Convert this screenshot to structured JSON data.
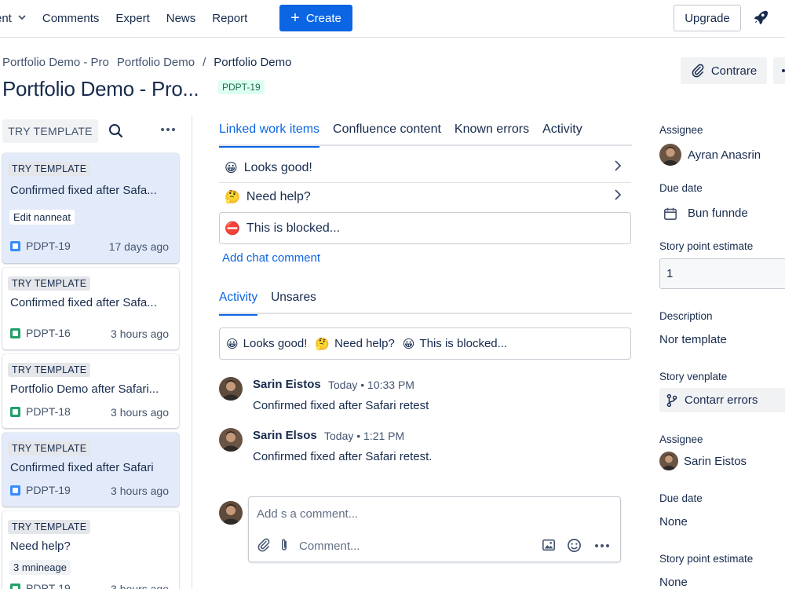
{
  "topnav": {
    "items": [
      {
        "label": "ent",
        "has_chevron": true
      },
      {
        "label": "Comments"
      },
      {
        "label": "Expert"
      },
      {
        "label": "News"
      },
      {
        "label": "Report"
      }
    ],
    "create_label": "Create",
    "upgrade_label": "Upgrade",
    "rocket_icon": "rocket-icon",
    "accent_color": "#0c66e4"
  },
  "header": {
    "breadcrumb": [
      "Portfolio Demo - Pro",
      "Portfolio Demo",
      "/",
      "Portfolio Demo"
    ],
    "title": "Portfolio Demo - Pro...",
    "issue_key": "PDPT-19",
    "compare_label": "Contrare"
  },
  "left_panel": {
    "try_template_label": "TRY TEMPLATE",
    "cards": [
      {
        "tag": "TRY TEMPLATE",
        "title": "Confirmed fixed after Safa...",
        "extra": "Edit nanneat",
        "key": "PDPT-19",
        "key_color": "#388bff",
        "ago": "17 days ago",
        "selected": true
      },
      {
        "tag": "TRY TEMPLATE",
        "title": "Confirmed fixed after Safa...",
        "extra": "",
        "key": "PDPT-16",
        "key_color": "#22a06b",
        "ago": "3 hours ago",
        "selected": false
      },
      {
        "tag": "TRY TEMPLATE",
        "title": "Portfolio Demo after Safari...",
        "extra": "",
        "key": "PDPT-18",
        "key_color": "#22a06b",
        "ago": "3 hours ago",
        "selected": false
      },
      {
        "tag": "TRY TEMPLATE",
        "title": "Confirmed fixed after Safari",
        "extra": "",
        "key": "PDPT-19",
        "key_color": "#388bff",
        "ago": "3 hours ago",
        "selected": true
      },
      {
        "tag": "TRY TEMPLATE",
        "title": "Need help?",
        "extra": "3 mnineage",
        "key": "PDPT-19",
        "key_color": "#22a06b",
        "ago": "3 hours ago",
        "selected": false
      }
    ]
  },
  "main": {
    "tabs": [
      "Linked work items",
      "Confluence content",
      "Known errors",
      "Activity"
    ],
    "replies": [
      {
        "emoji": "😀",
        "label": "Looks good!"
      },
      {
        "emoji": "🤔",
        "label": "Need help?"
      },
      {
        "emoji": "⛔",
        "label": "This is blocked..."
      }
    ],
    "add_chat_label": "Add chat comment",
    "activity_tabs": [
      "Activity",
      "Unsares"
    ],
    "quick_replies": [
      {
        "emoji": "😀",
        "label": "Looks good!"
      },
      {
        "emoji": "🤔",
        "label": "Need help?"
      },
      {
        "emoji": "😀",
        "label": "This is blocked..."
      }
    ],
    "comments": [
      {
        "author": "Sarin Eistos",
        "time": "Today • 10:33 PM",
        "text": "Confirmed fixed after Safari retest"
      },
      {
        "author": "Sarin Elsos",
        "time": "Today • 1:21 PM",
        "text": "Confirmed fixed after Safari retest."
      }
    ],
    "editor": {
      "placeholder": "Add s a comment...",
      "secondary_placeholder": "Comment..."
    }
  },
  "right_panel": {
    "assignee_label": "Assignee",
    "assignee": "Ayran Anasrin",
    "due_date_label": "Due date",
    "due_date": "Bun funnde",
    "story_point_label": "Story point estimate",
    "story_point_value": "1",
    "description_label": "Description",
    "description": "Nor template",
    "story_template_label": "Story venplate",
    "branch_button": "Contarr errors",
    "assignee2_label": "Assignee",
    "assignee2": "Sarin Eistos",
    "due_date2_label": "Due date",
    "due_date2": "None",
    "story_point2_label": "Story point estimate",
    "story_point2": "None"
  }
}
